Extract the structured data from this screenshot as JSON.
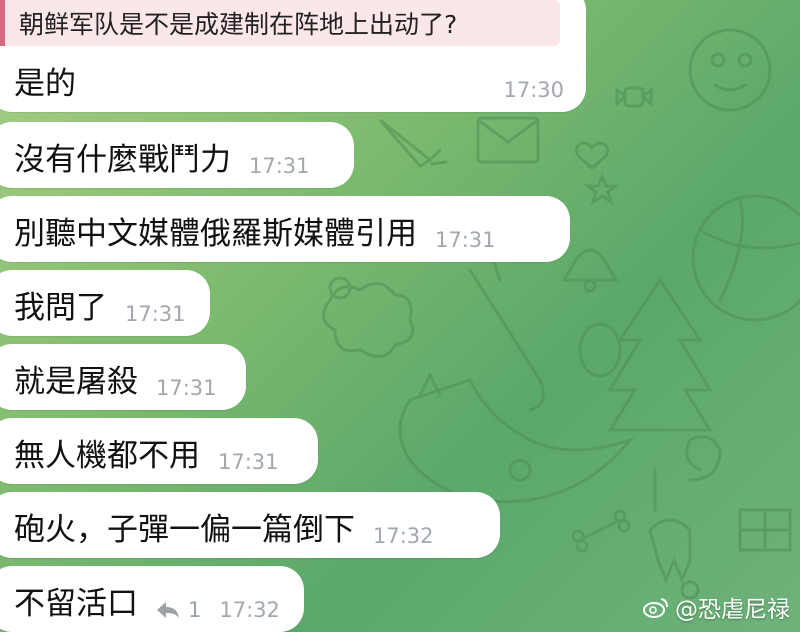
{
  "chat": {
    "quoted_text": "朝鲜军队是不是成建制在阵地上出动了?",
    "messages": [
      {
        "text": "是的",
        "time": "17:30"
      },
      {
        "text": "沒有什麼戰鬥力",
        "time": "17:31"
      },
      {
        "text": "別聽中文媒體俄羅斯媒體引用",
        "time": "17:31"
      },
      {
        "text": "我問了",
        "time": "17:31"
      },
      {
        "text": "就是屠殺",
        "time": "17:31"
      },
      {
        "text": "無人機都不用",
        "time": "17:31"
      },
      {
        "text": "砲火，子彈一偏一篇倒下",
        "time": "17:32"
      },
      {
        "text": "不留活口",
        "time": "17:32",
        "reply_count": "1"
      }
    ]
  },
  "watermark": {
    "text": "@恐虐尼禄",
    "icon": "weibo-icon"
  },
  "colors": {
    "bubble": "#ffffff",
    "quote_bg": "#fbe6ea",
    "quote_bar": "#d96a84",
    "time_text": "#a2a8ad",
    "wallpaper": "#7fbb6f"
  }
}
